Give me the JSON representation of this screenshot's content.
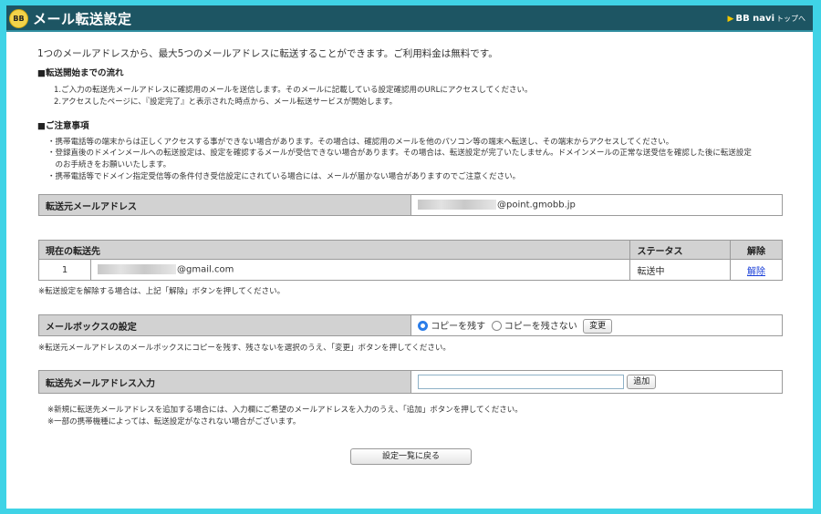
{
  "header": {
    "logo_text": "BB",
    "title": "メール転送設定",
    "nav_label": "BB navi",
    "nav_suffix": "トップへ"
  },
  "intro": "1つのメールアドレスから、最大5つのメールアドレスに転送することができます。ご利用料金は無料です。",
  "flow": {
    "heading": "■転送開始までの流れ",
    "steps": [
      "1.ご入力の転送先メールアドレスに確認用のメールを送信します。そのメールに記載している設定確認用のURLにアクセスしてください。",
      "2.アクセスしたページに、『設定完了』と表示された時点から、メール転送サービスが開始します。"
    ]
  },
  "cautions": {
    "heading": "■ご注意事項",
    "items": [
      "・携帯電話等の端末からは正しくアクセスする事ができない場合があります。その場合は、確認用のメールを他のパソコン等の端末へ転送し、その端末からアクセスしてください。",
      "・登録直後のドメインメールへの転送設定は、設定を確認するメールが受信できない場合があります。その場合は、転送設定が完了いたしません。ドメインメールの正常な送受信を確認した後に転送設定",
      "　のお手続きをお願いいたします。",
      "・携帯電話等でドメイン指定受信等の条件付き受信設定にされている場合には、メールが届かない場合がありますのでご注意ください。"
    ]
  },
  "source": {
    "label": "転送元メールアドレス",
    "address_domain": "@point.gmobb.jp"
  },
  "destinations": {
    "col_current": "現在の転送先",
    "col_status": "ステータス",
    "col_cancel": "解除",
    "rows": [
      {
        "index": "1",
        "address_domain": "@gmail.com",
        "status": "転送中",
        "cancel_link": "解除"
      }
    ],
    "note": "※転送設定を解除する場合は、上記「解除」ボタンを押してください。"
  },
  "mailbox": {
    "label": "メールボックスの設定",
    "option_keep": "コピーを残す",
    "option_nokeep": "コピーを残さない",
    "selected": "コピーを残す",
    "change_button": "変更",
    "note": "※転送元メールアドレスのメールボックスにコピーを残す、残さないを選択のうえ、「変更」ボタンを押してください。"
  },
  "add": {
    "label": "転送先メールアドレス入力",
    "input_value": "",
    "add_button": "追加",
    "notes": [
      "※新規に転送先メールアドレスを追加する場合には、入力欄にご希望のメールアドレスを入力のうえ、「追加」ボタンを押してください。",
      "※一部の携帯機種によっては、転送設定がなされない場合がございます。"
    ]
  },
  "back_button": "設定一覧に戻る",
  "colors": {
    "header_bg": "#1d5563",
    "page_bg": "#3fd3e6",
    "accent": "#2b7de9"
  }
}
